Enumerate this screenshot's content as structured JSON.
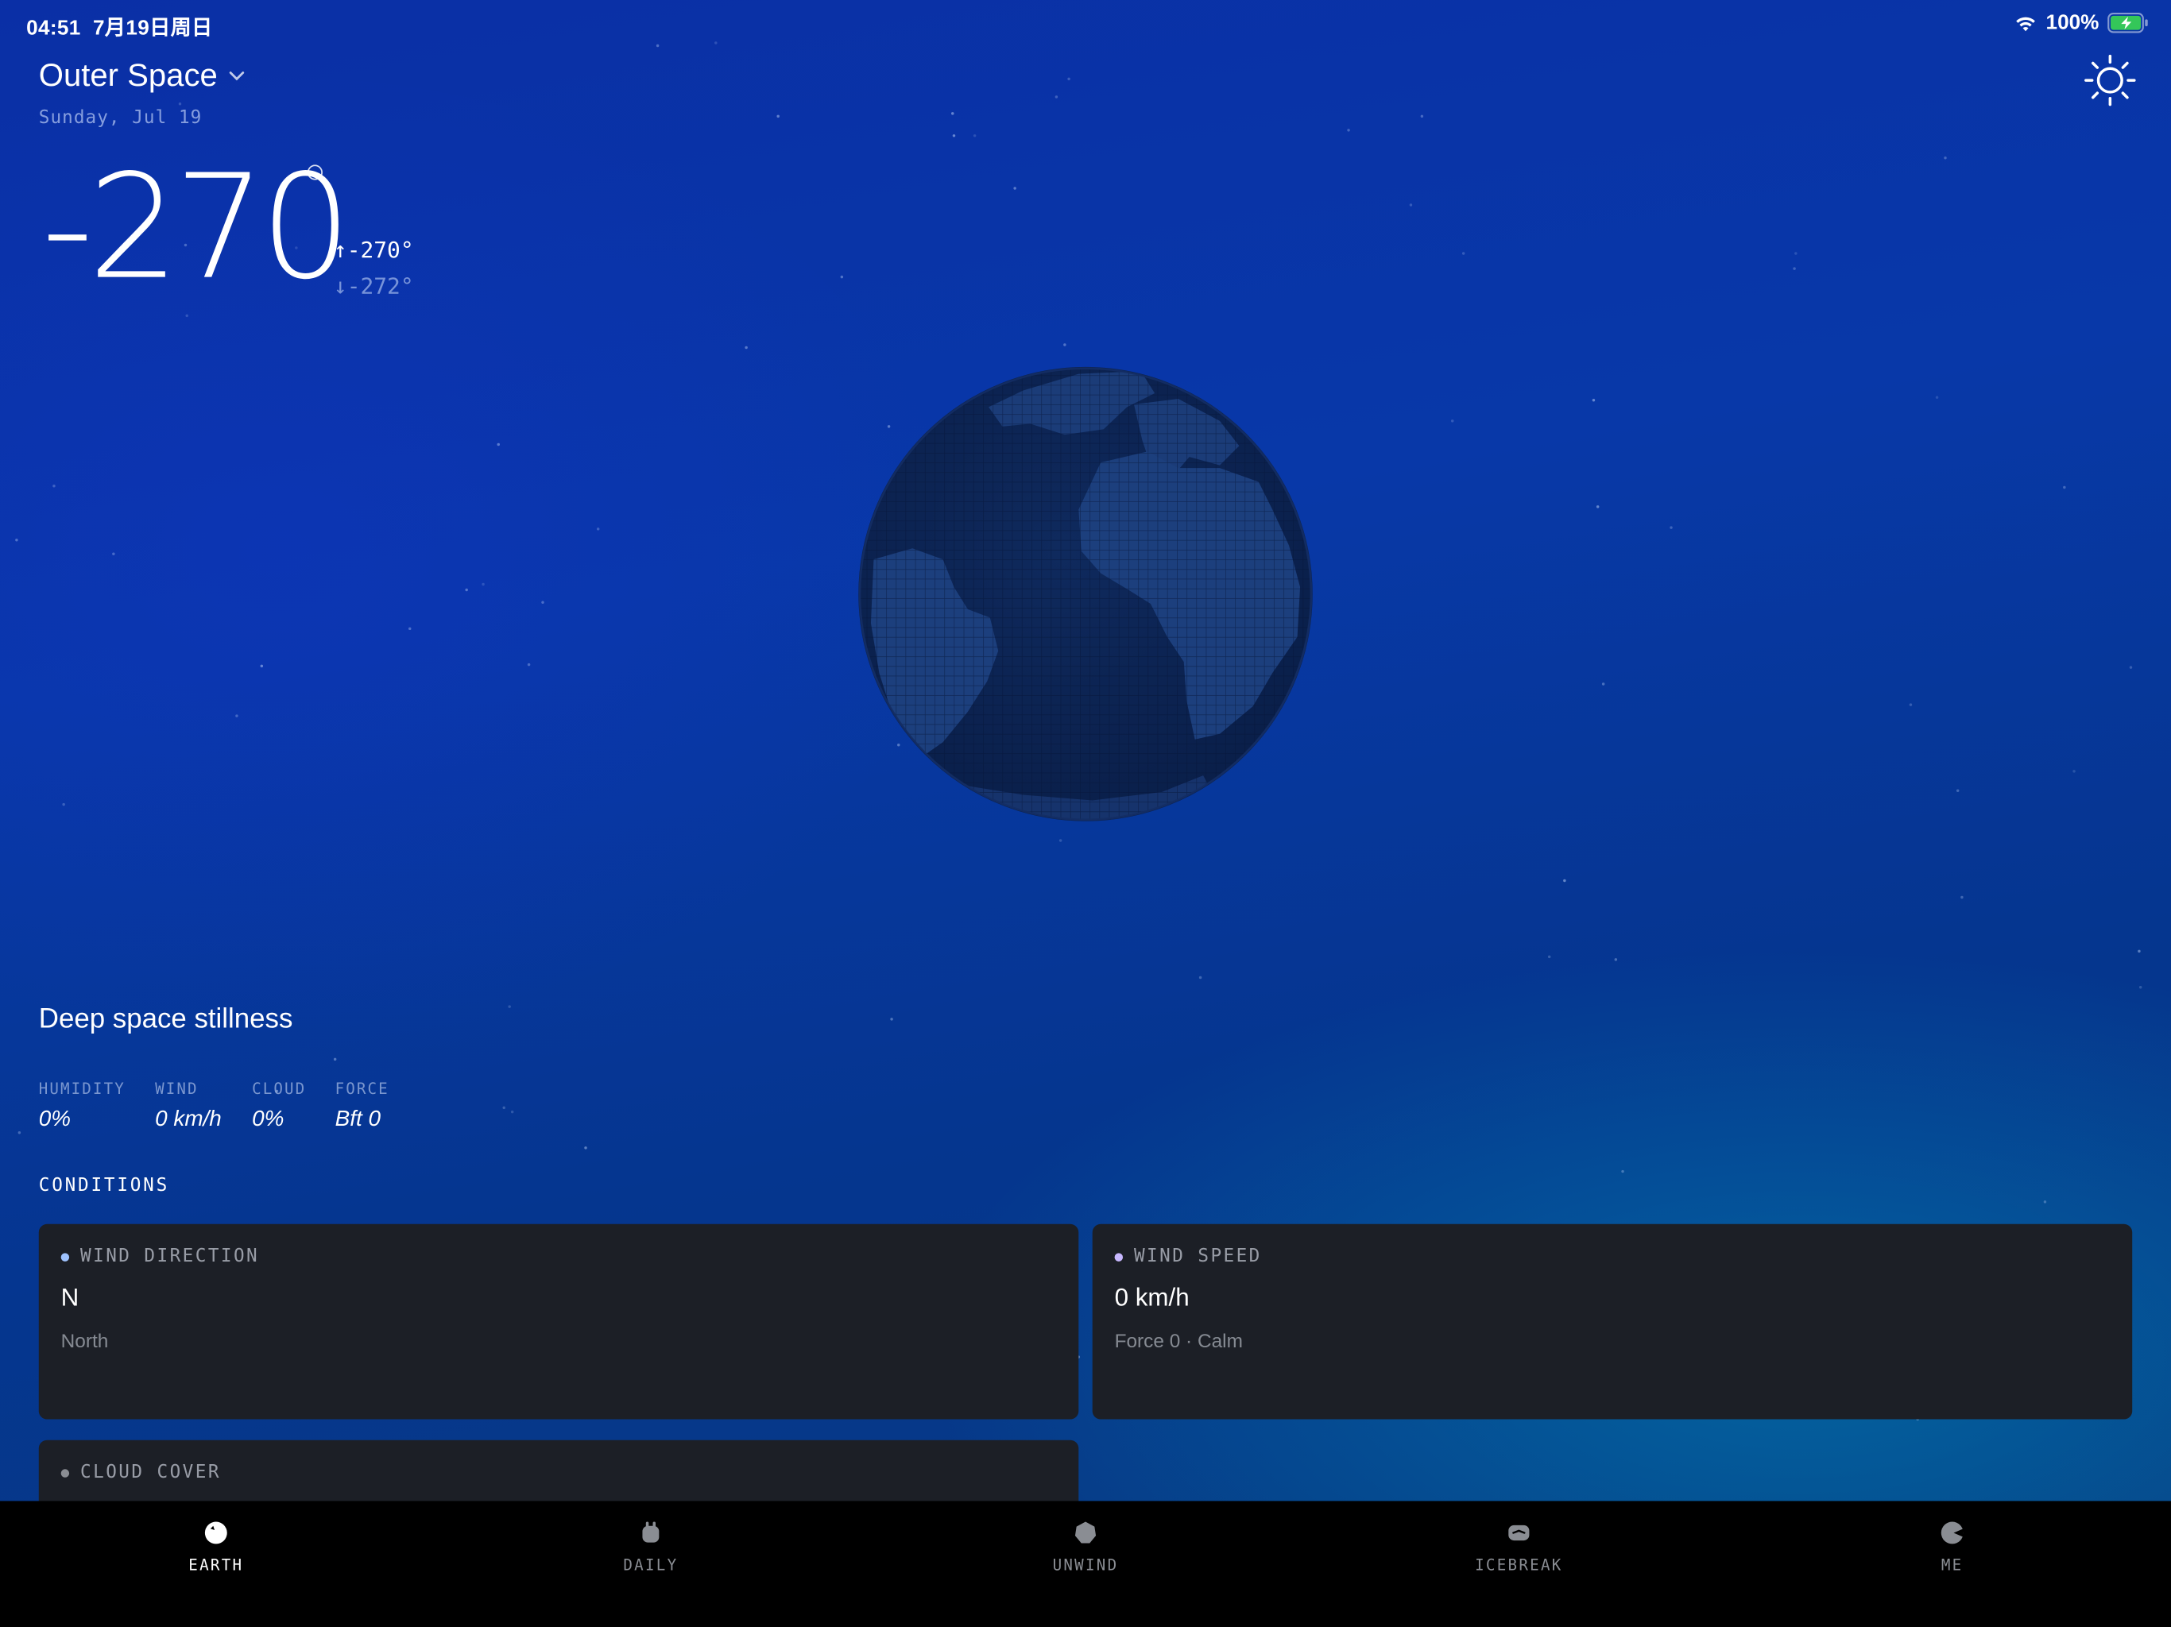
{
  "status_bar": {
    "time": "04:51",
    "date": "7月19日周日",
    "battery": "100%"
  },
  "header": {
    "location": "Outer Space",
    "date": "Sunday, Jul 19"
  },
  "temperature": {
    "current": "-270",
    "high": "↑-270°",
    "low": "↓-272°"
  },
  "summary": "Deep space stillness",
  "metrics": [
    {
      "label": "HUMIDITY",
      "value": "0%"
    },
    {
      "label": "WIND",
      "value": "0 km/h"
    },
    {
      "label": "CLOUD",
      "value": "0%"
    },
    {
      "label": "FORCE",
      "value": "Bft 0"
    }
  ],
  "conditions": {
    "title": "CONDITIONS",
    "cards": [
      {
        "title": "WIND DIRECTION",
        "value": "N",
        "sub": "North",
        "dot_color": "#9fc3ff"
      },
      {
        "title": "WIND SPEED",
        "value": "0 km/h",
        "sub": "Force 0 · Calm",
        "dot_color": "#c8b8ff"
      },
      {
        "title": "CLOUD COVER",
        "value": "",
        "sub": "",
        "dot_color": "#8a8d93"
      }
    ]
  },
  "tabs": [
    {
      "label": "EARTH",
      "icon": "earth-icon",
      "active": true
    },
    {
      "label": "DAILY",
      "icon": "daily-icon",
      "active": false
    },
    {
      "label": "UNWIND",
      "icon": "unwind-icon",
      "active": false
    },
    {
      "label": "ICEBREAK",
      "icon": "icebreak-icon",
      "active": false
    },
    {
      "label": "ME",
      "icon": "me-icon",
      "active": false
    }
  ],
  "colors": {
    "background": "#0838a8",
    "card": "#1c1f26",
    "tab_bar": "#000000",
    "battery": "#34c759"
  }
}
